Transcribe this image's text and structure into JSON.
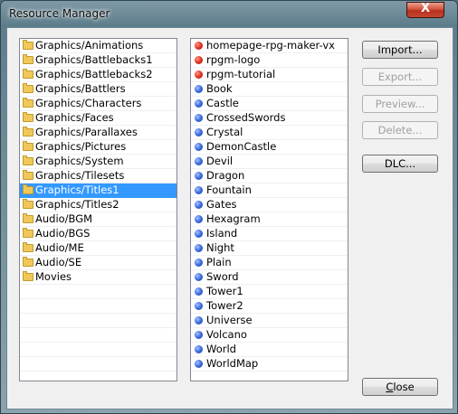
{
  "window": {
    "title": "Resource Manager",
    "close_glyph": "X"
  },
  "folders": [
    {
      "label": "Graphics/Animations",
      "selected": false
    },
    {
      "label": "Graphics/Battlebacks1",
      "selected": false
    },
    {
      "label": "Graphics/Battlebacks2",
      "selected": false
    },
    {
      "label": "Graphics/Battlers",
      "selected": false
    },
    {
      "label": "Graphics/Characters",
      "selected": false
    },
    {
      "label": "Graphics/Faces",
      "selected": false
    },
    {
      "label": "Graphics/Parallaxes",
      "selected": false
    },
    {
      "label": "Graphics/Pictures",
      "selected": false
    },
    {
      "label": "Graphics/System",
      "selected": false
    },
    {
      "label": "Graphics/Tilesets",
      "selected": false
    },
    {
      "label": "Graphics/Titles1",
      "selected": true
    },
    {
      "label": "Graphics/Titles2",
      "selected": false
    },
    {
      "label": "Audio/BGM",
      "selected": false
    },
    {
      "label": "Audio/BGS",
      "selected": false
    },
    {
      "label": "Audio/ME",
      "selected": false
    },
    {
      "label": "Audio/SE",
      "selected": false
    },
    {
      "label": "Movies",
      "selected": false
    }
  ],
  "files": [
    {
      "label": "homepage-rpg-maker-vx",
      "icon": "red-dot-icon"
    },
    {
      "label": "rpgm-logo",
      "icon": "red-dot-icon"
    },
    {
      "label": "rpgm-tutorial",
      "icon": "red-dot-icon"
    },
    {
      "label": "Book",
      "icon": "blue-dot-icon"
    },
    {
      "label": "Castle",
      "icon": "blue-dot-icon"
    },
    {
      "label": "CrossedSwords",
      "icon": "blue-dot-icon"
    },
    {
      "label": "Crystal",
      "icon": "blue-dot-icon"
    },
    {
      "label": "DemonCastle",
      "icon": "blue-dot-icon"
    },
    {
      "label": "Devil",
      "icon": "blue-dot-icon"
    },
    {
      "label": "Dragon",
      "icon": "blue-dot-icon"
    },
    {
      "label": "Fountain",
      "icon": "blue-dot-icon"
    },
    {
      "label": "Gates",
      "icon": "blue-dot-icon"
    },
    {
      "label": "Hexagram",
      "icon": "blue-dot-icon"
    },
    {
      "label": "Island",
      "icon": "blue-dot-icon"
    },
    {
      "label": "Night",
      "icon": "blue-dot-icon"
    },
    {
      "label": "Plain",
      "icon": "blue-dot-icon"
    },
    {
      "label": "Sword",
      "icon": "blue-dot-icon"
    },
    {
      "label": "Tower1",
      "icon": "blue-dot-icon"
    },
    {
      "label": "Tower2",
      "icon": "blue-dot-icon"
    },
    {
      "label": "Universe",
      "icon": "blue-dot-icon"
    },
    {
      "label": "Volcano",
      "icon": "blue-dot-icon"
    },
    {
      "label": "World",
      "icon": "blue-dot-icon"
    },
    {
      "label": "WorldMap",
      "icon": "blue-dot-icon"
    }
  ],
  "buttons": {
    "import": "Import...",
    "export": "Export...",
    "preview": "Preview...",
    "delete": "Delete...",
    "dlc": "DLC...",
    "close": "Close"
  },
  "colors": {
    "selection": "#3399ff",
    "red_dot": "#e23222",
    "blue_dot": "#3b6ce0"
  }
}
